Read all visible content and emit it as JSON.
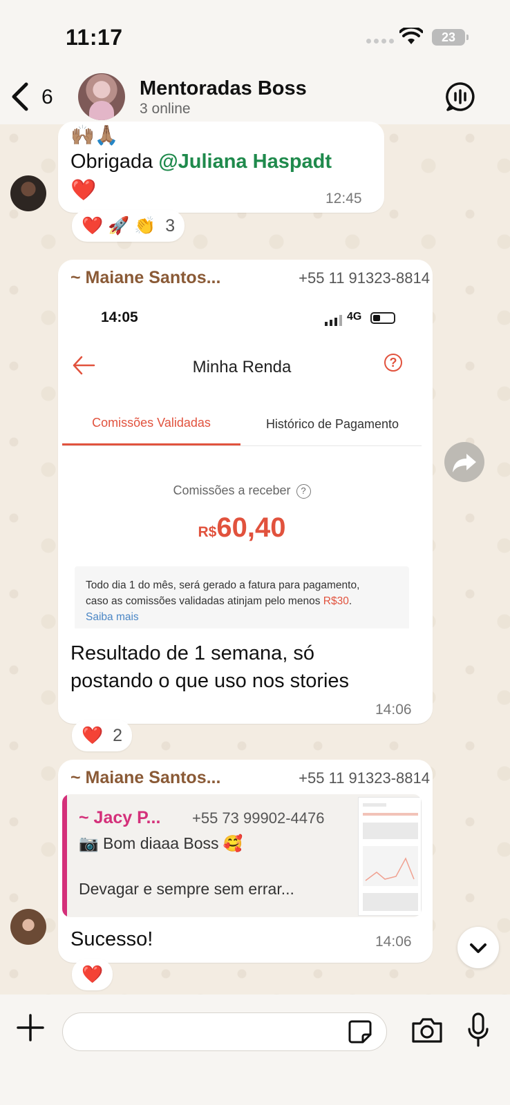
{
  "status_bar": {
    "time": "11:17",
    "battery": "23"
  },
  "header": {
    "back_count": "6",
    "group_name": "Mentoradas Boss",
    "group_status": "3 online"
  },
  "messages": [
    {
      "emojis": "🙌🏽🙏🏽",
      "text_prefix": "Obrigada ",
      "mention": "@Juliana Haspadt",
      "trailing_emoji": "❤️",
      "time": "12:45",
      "reactions": {
        "emojis": "❤️ 🚀 👏",
        "count": "3"
      }
    },
    {
      "sender": "~ Maiane Santos...",
      "phone": "+55 11 91323-8814",
      "screenshot": {
        "time": "14:05",
        "network": "4G",
        "title": "Minha Renda",
        "help": "?",
        "tab_active": "Comissões Validadas",
        "tab_other": "Histórico de Pagamento",
        "receive_label": "Comissões a receber",
        "currency": "R$",
        "amount": "60,40",
        "info_line1": "Todo dia 1 do mês, será gerado a fatura para pagamento,",
        "info_line2_a": "caso as comissões validadas atinjam pelo menos ",
        "info_line2_accent": "R$30",
        "info_line2_b": ".",
        "info_link": "Saiba mais"
      },
      "text_line1": "Resultado de 1 semana, só",
      "text_line2": "postando o que uso nos stories",
      "time": "14:06",
      "reactions": {
        "emojis": "❤️",
        "count": "2"
      }
    },
    {
      "sender": "~ Maiane Santos...",
      "phone": "+55 11 91323-8814",
      "quote": {
        "name": "~ Jacy P...",
        "phone": "+55 73 99902-4476",
        "line1": "📷 Bom diaaa Boss 🥰",
        "line2": "Devagar e sempre sem errar..."
      },
      "text": "Sucesso!",
      "time": "14:06",
      "reactions": {
        "emojis": "❤️"
      }
    }
  ],
  "composer": {
    "placeholder": ""
  },
  "colors": {
    "accent_orange": "#e1523d",
    "mention_green": "#1f8a4c",
    "quote_pink": "#d4307a",
    "sender_brown": "#8a5a36"
  }
}
